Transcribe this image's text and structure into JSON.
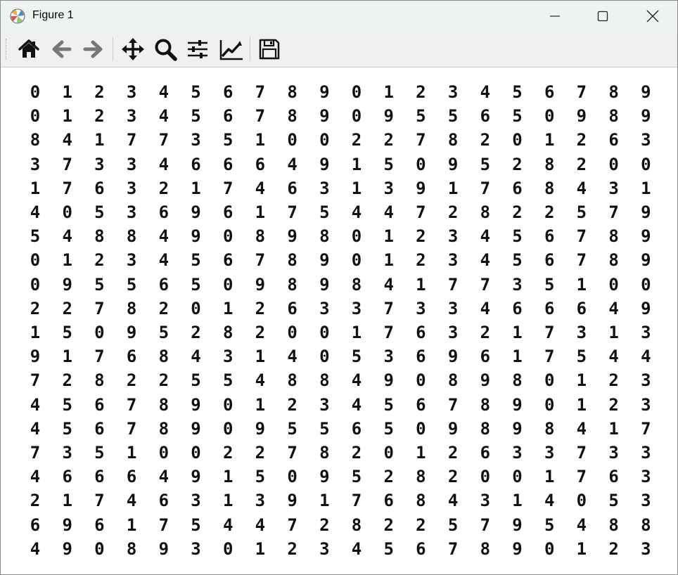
{
  "window": {
    "title": "Figure 1",
    "icons": {
      "app": "matplotlib-logo-icon",
      "minimize": "minimize-icon",
      "maximize": "maximize-icon",
      "close": "close-icon"
    }
  },
  "toolbar": {
    "buttons": [
      {
        "name": "home-button",
        "icon": "home-icon"
      },
      {
        "name": "back-button",
        "icon": "arrow-left-icon"
      },
      {
        "name": "forward-button",
        "icon": "arrow-right-icon"
      },
      {
        "name": "pan-button",
        "icon": "move-icon"
      },
      {
        "name": "zoom-button",
        "icon": "magnifier-icon"
      },
      {
        "name": "subplots-button",
        "icon": "sliders-icon"
      },
      {
        "name": "edit-axes-button",
        "icon": "line-chart-icon"
      },
      {
        "name": "save-button",
        "icon": "floppy-disk-icon"
      }
    ]
  },
  "figure": {
    "digit_grid": [
      [
        "0",
        "1",
        "2",
        "3",
        "4",
        "5",
        "6",
        "7",
        "8",
        "9",
        "0",
        "1",
        "2",
        "3",
        "4",
        "5",
        "6",
        "7",
        "8",
        "9"
      ],
      [
        "0",
        "1",
        "2",
        "3",
        "4",
        "5",
        "6",
        "7",
        "8",
        "9",
        "0",
        "9",
        "5",
        "5",
        "6",
        "5",
        "0",
        "9",
        "8",
        "9"
      ],
      [
        "8",
        "4",
        "1",
        "7",
        "7",
        "3",
        "5",
        "1",
        "0",
        "0",
        "2",
        "2",
        "7",
        "8",
        "2",
        "0",
        "1",
        "2",
        "6",
        "3"
      ],
      [
        "3",
        "7",
        "3",
        "3",
        "4",
        "6",
        "6",
        "6",
        "4",
        "9",
        "1",
        "5",
        "0",
        "9",
        "5",
        "2",
        "8",
        "2",
        "0",
        "0"
      ],
      [
        "1",
        "7",
        "6",
        "3",
        "2",
        "1",
        "7",
        "4",
        "6",
        "3",
        "1",
        "3",
        "9",
        "1",
        "7",
        "6",
        "8",
        "4",
        "3",
        "1"
      ],
      [
        "4",
        "0",
        "5",
        "3",
        "6",
        "9",
        "6",
        "1",
        "7",
        "5",
        "4",
        "4",
        "7",
        "2",
        "8",
        "2",
        "2",
        "5",
        "7",
        "9"
      ],
      [
        "5",
        "4",
        "8",
        "8",
        "4",
        "9",
        "0",
        "8",
        "9",
        "8",
        "0",
        "1",
        "2",
        "3",
        "4",
        "5",
        "6",
        "7",
        "8",
        "9"
      ],
      [
        "0",
        "1",
        "2",
        "3",
        "4",
        "5",
        "6",
        "7",
        "8",
        "9",
        "0",
        "1",
        "2",
        "3",
        "4",
        "5",
        "6",
        "7",
        "8",
        "9"
      ],
      [
        "0",
        "9",
        "5",
        "5",
        "6",
        "5",
        "0",
        "9",
        "8",
        "9",
        "8",
        "4",
        "1",
        "7",
        "7",
        "3",
        "5",
        "1",
        "0",
        "0"
      ],
      [
        "2",
        "2",
        "7",
        "8",
        "2",
        "0",
        "1",
        "2",
        "6",
        "3",
        "3",
        "7",
        "3",
        "3",
        "4",
        "6",
        "6",
        "6",
        "4",
        "9"
      ],
      [
        "1",
        "5",
        "0",
        "9",
        "5",
        "2",
        "8",
        "2",
        "0",
        "0",
        "1",
        "7",
        "6",
        "3",
        "2",
        "1",
        "7",
        "3",
        "1",
        "3"
      ],
      [
        "9",
        "1",
        "7",
        "6",
        "8",
        "4",
        "3",
        "1",
        "4",
        "0",
        "5",
        "3",
        "6",
        "9",
        "6",
        "1",
        "7",
        "5",
        "4",
        "4"
      ],
      [
        "7",
        "2",
        "8",
        "2",
        "2",
        "5",
        "5",
        "4",
        "8",
        "8",
        "4",
        "9",
        "0",
        "8",
        "9",
        "8",
        "0",
        "1",
        "2",
        "3"
      ],
      [
        "4",
        "5",
        "6",
        "7",
        "8",
        "9",
        "0",
        "1",
        "2",
        "3",
        "4",
        "5",
        "6",
        "7",
        "8",
        "9",
        "0",
        "1",
        "2",
        "3"
      ],
      [
        "4",
        "5",
        "6",
        "7",
        "8",
        "9",
        "0",
        "9",
        "5",
        "5",
        "6",
        "5",
        "0",
        "9",
        "8",
        "9",
        "8",
        "4",
        "1",
        "7"
      ],
      [
        "7",
        "3",
        "5",
        "1",
        "0",
        "0",
        "2",
        "2",
        "7",
        "8",
        "2",
        "0",
        "1",
        "2",
        "6",
        "3",
        "3",
        "7",
        "3",
        "3"
      ],
      [
        "4",
        "6",
        "6",
        "6",
        "4",
        "9",
        "1",
        "5",
        "0",
        "9",
        "5",
        "2",
        "8",
        "2",
        "0",
        "0",
        "1",
        "7",
        "6",
        "3"
      ],
      [
        "2",
        "1",
        "7",
        "4",
        "6",
        "3",
        "1",
        "3",
        "9",
        "1",
        "7",
        "6",
        "8",
        "4",
        "3",
        "1",
        "4",
        "0",
        "5",
        "3"
      ],
      [
        "6",
        "9",
        "6",
        "1",
        "7",
        "5",
        "4",
        "4",
        "7",
        "2",
        "8",
        "2",
        "2",
        "5",
        "7",
        "9",
        "5",
        "4",
        "8",
        "8"
      ],
      [
        "4",
        "9",
        "0",
        "8",
        "9",
        "3",
        "0",
        "1",
        "2",
        "3",
        "4",
        "5",
        "6",
        "7",
        "8",
        "9",
        "0",
        "1",
        "2",
        "3"
      ]
    ]
  }
}
